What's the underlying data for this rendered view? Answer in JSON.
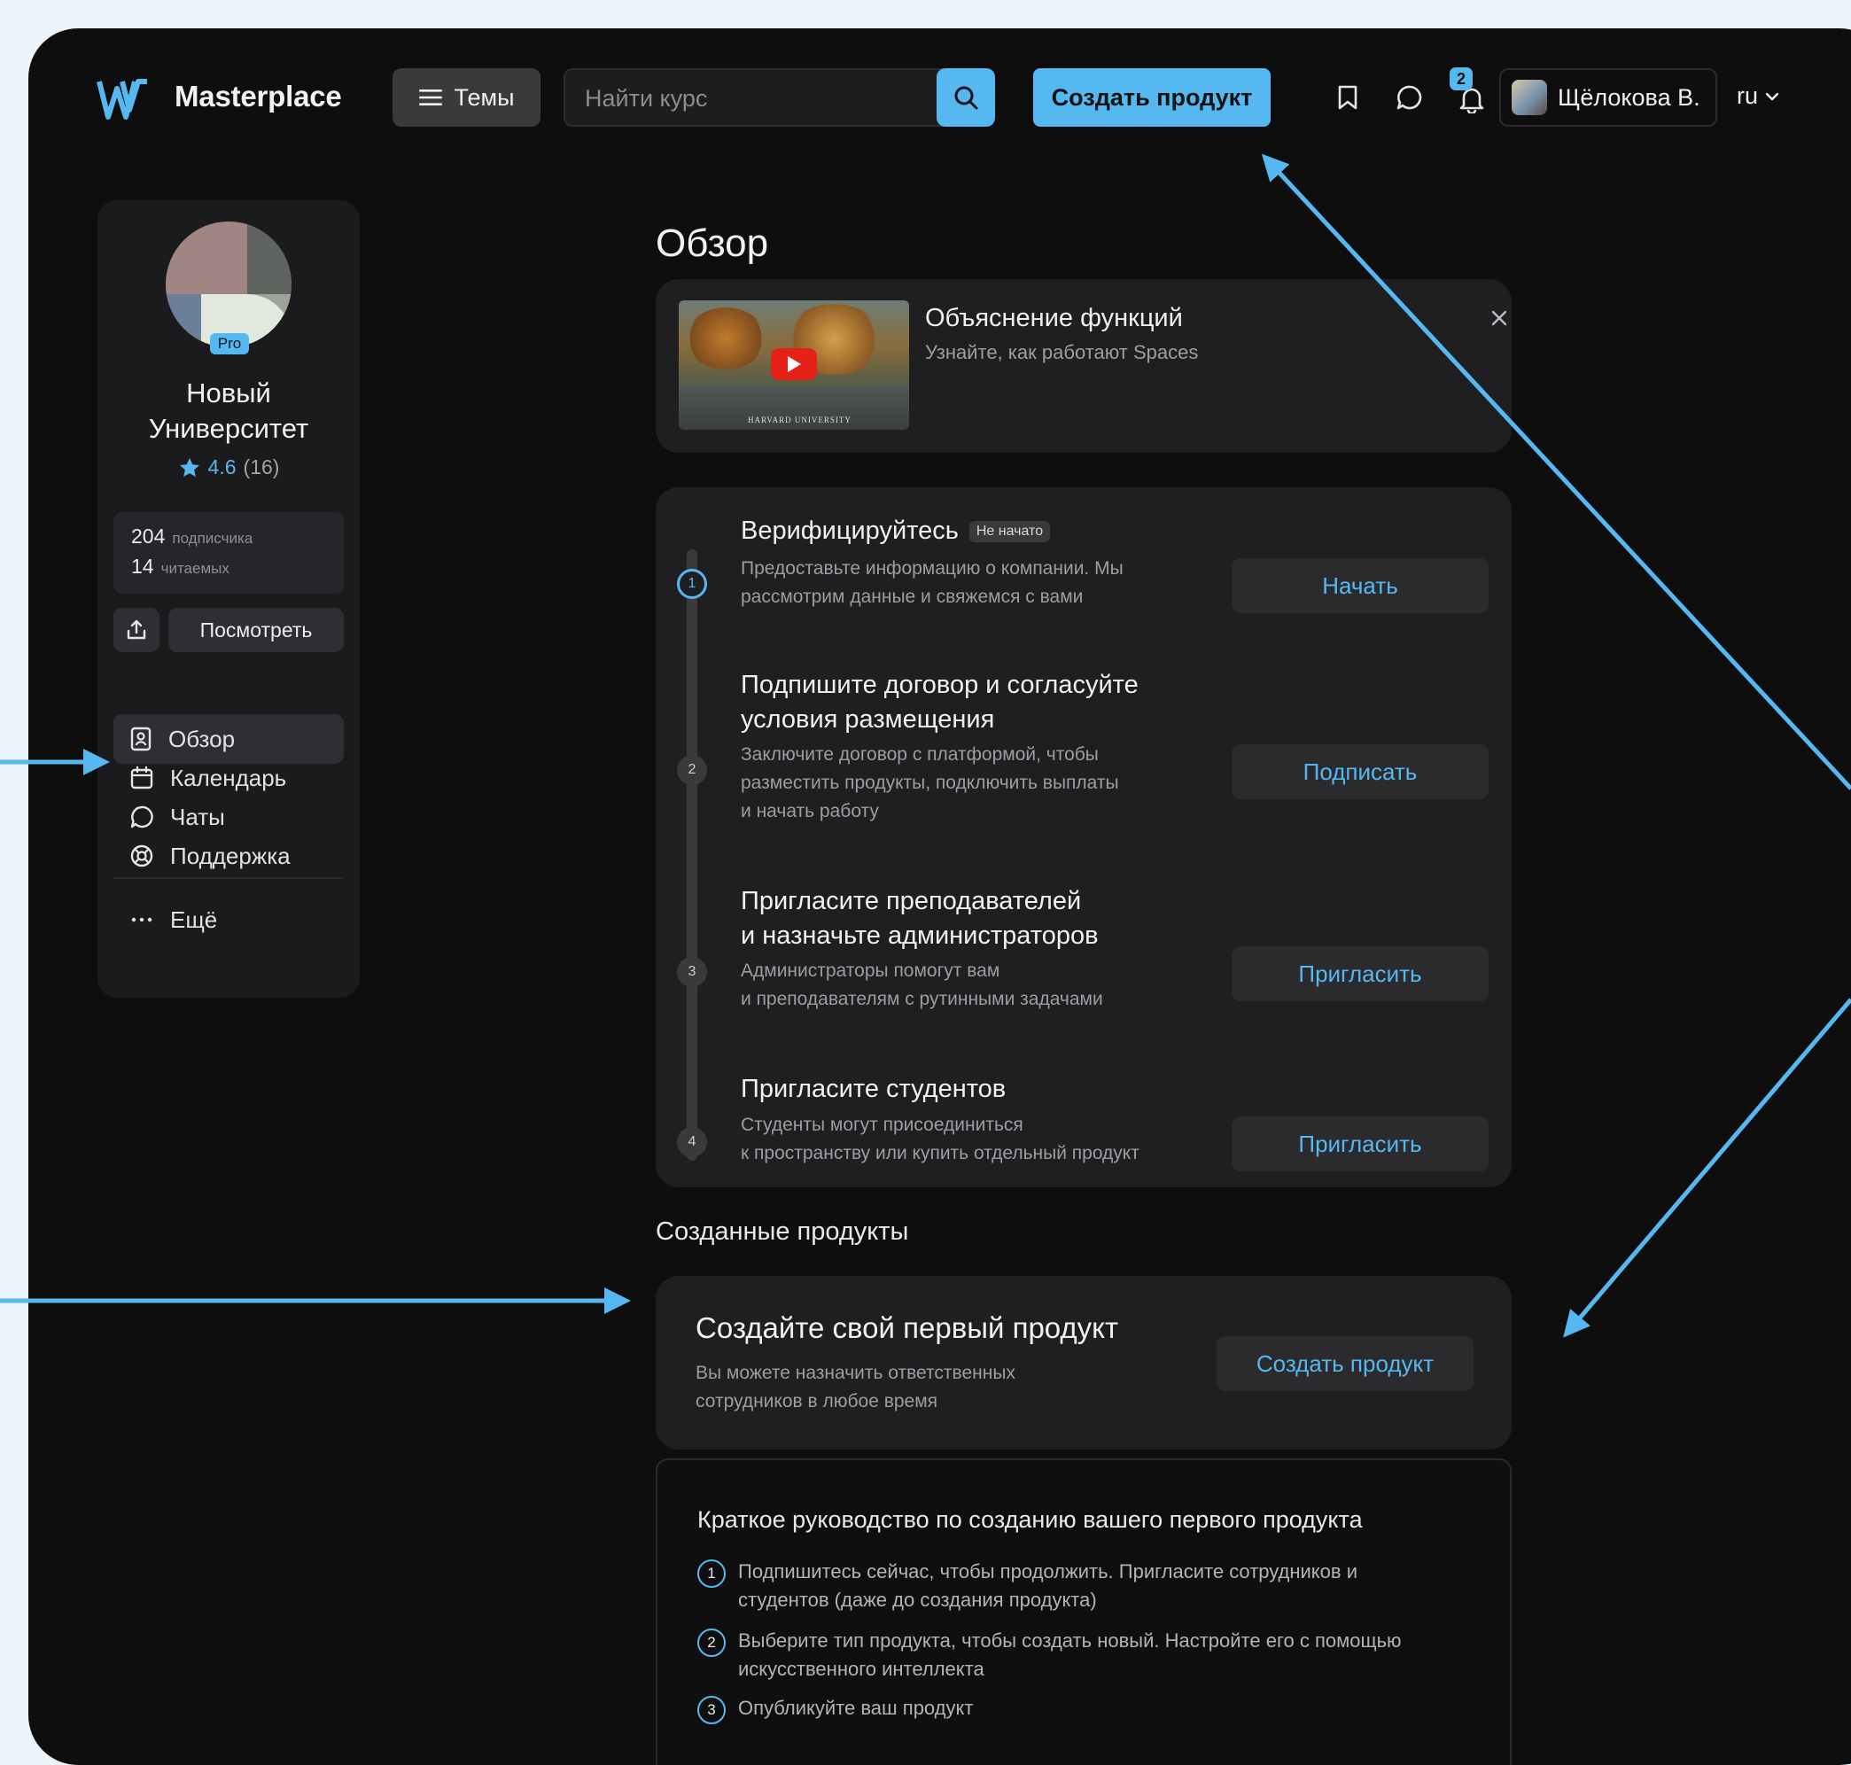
{
  "header": {
    "brand": "Masterplace",
    "themes_label": "Темы",
    "search_placeholder": "Найти курс",
    "create_product_label": "Создать продукт",
    "notifications_count": "2",
    "user_name": "Щёлокова В.",
    "language": "ru"
  },
  "sidebar": {
    "pro_badge": "Pro",
    "org_name_line1": "Новый",
    "org_name_line2": "Университет",
    "rating_value": "4.6",
    "rating_count": "(16)",
    "subscribers_count": "204",
    "subscribers_label": "подписчика",
    "following_count": "14",
    "following_label": "читаемых",
    "view_label": "Посмотреть",
    "nav": [
      {
        "label": "Обзор",
        "icon": "overview-icon"
      },
      {
        "label": "Календарь",
        "icon": "calendar-icon"
      },
      {
        "label": "Чаты",
        "icon": "chat-icon"
      },
      {
        "label": "Поддержка",
        "icon": "support-icon"
      }
    ],
    "more_label": "Ещё"
  },
  "main": {
    "title": "Обзор",
    "video": {
      "title": "Объяснение функций",
      "subtitle": "Узнайте, как работают Spaces",
      "thumb_caption": "HARVARD UNIVERSITY"
    },
    "steps": [
      {
        "num": "1",
        "title": "Верифицируйтесь",
        "status": "Не начато",
        "desc_line1": "Предоставьте информацию о компании. Мы",
        "desc_line2": "рассмотрим данные и свяжемся с вами",
        "button": "Начать"
      },
      {
        "num": "2",
        "title_line1": "Подпишите договор и согласуйте",
        "title_line2": "условия размещения",
        "desc_line1": "Заключите договор с платформой, чтобы",
        "desc_line2": "разместить продукты, подключить выплаты",
        "desc_line3": "и начать работу",
        "button": "Подписать"
      },
      {
        "num": "3",
        "title_line1": "Пригласите преподавателей",
        "title_line2": "и назначьте администраторов",
        "desc_line1": "Администраторы помогут вам",
        "desc_line2": "и преподавателям с рутинными задачами",
        "button": "Пригласить"
      },
      {
        "num": "4",
        "title": "Пригласите студентов",
        "desc_line1": "Студенты могут присоединиться",
        "desc_line2": "к пространству или купить отдельный продукт",
        "button": "Пригласить"
      }
    ],
    "products_section_title": "Созданные продукты",
    "create_card": {
      "title": "Создайте свой первый продукт",
      "desc_line1": "Вы можете назначить ответственных",
      "desc_line2": "сотрудников в любое время",
      "button": "Создать продукт"
    },
    "guide": {
      "title": "Краткое руководство по созданию вашего первого продукта",
      "items": [
        {
          "num": "1",
          "line1": "Подпишитесь сейчас, чтобы продолжить. Пригласите сотрудников и",
          "line2": "студентов (даже до создания продукта)"
        },
        {
          "num": "2",
          "line1": "Выберите тип продукта, чтобы создать новый. Настройте его с помощью",
          "line2": "искусственного интеллекта"
        },
        {
          "num": "3",
          "line1": "Опубликуйте ваш продукт"
        }
      ]
    }
  },
  "colors": {
    "accent": "#56b8f1",
    "background": "#0e0e0f",
    "card": "#1f1f21",
    "outer": "#ebf4fc"
  }
}
